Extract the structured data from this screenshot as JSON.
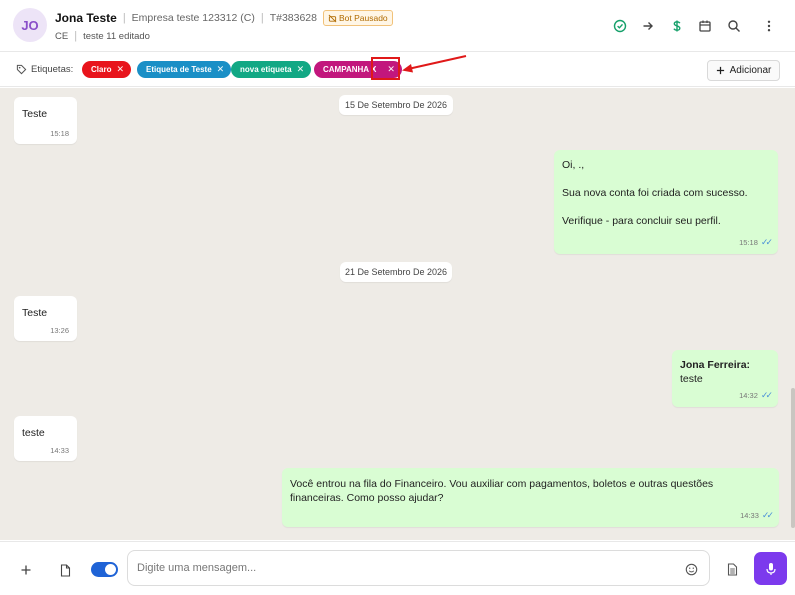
{
  "header": {
    "avatar_initials": "JO",
    "contact_name": "Jona Teste",
    "company": "Empresa teste 123312 (C)",
    "ticket": "T#383628",
    "bot_badge": "Bot Pausado",
    "state": "CE",
    "status_text": "teste 11 editado",
    "icons": [
      "check-circle-icon",
      "arrow-right-icon",
      "dollar-icon",
      "calendar-icon",
      "search-icon",
      "more-vertical-icon"
    ]
  },
  "tags_bar": {
    "label": "Etiquetas:",
    "tags": [
      {
        "label": "Claro",
        "color": "#e8141c"
      },
      {
        "label": "Etiqueta de Teste",
        "color": "#1a8fc6"
      },
      {
        "label": "nova etiqueta",
        "color": "#12a884"
      },
      {
        "label": "CAMPANHA X",
        "color": "#c2177d"
      }
    ],
    "add_label": "Adicionar",
    "highlight_color": "#e01919"
  },
  "chat": {
    "dates": [
      "15 De Setembro De 2026",
      "21 De Setembro De 2026"
    ],
    "messages": [
      {
        "direction": "in",
        "text": "Teste",
        "time": "15:18"
      },
      {
        "direction": "out",
        "lines": [
          "Oi, .,",
          "",
          "Sua nova conta foi criada com sucesso.",
          "",
          "Verifique - para concluir seu perfil."
        ],
        "time": "15:18",
        "read": true
      },
      {
        "direction": "in",
        "text": "Teste",
        "time": "13:26"
      },
      {
        "direction": "out",
        "author": "Jona Ferreira:",
        "text": "teste",
        "time": "14:32",
        "read": true
      },
      {
        "direction": "in",
        "text": "teste",
        "time": "14:33"
      },
      {
        "direction": "out",
        "lines": [
          "Você entrou na fila do Financeiro. Vou auxiliar com pagamentos, boletos e outras questões",
          "financeiras. Como posso ajudar?"
        ],
        "time": "14:33",
        "read": true
      }
    ]
  },
  "composer": {
    "placeholder": "Digite uma mensagem...",
    "value": "",
    "toggle_on": true
  },
  "colors": {
    "accent": "#7c3aed",
    "toggle": "#1f63d6",
    "chat_bg": "#eeebe6",
    "outgoing_bubble": "#d9fdd3",
    "read_check": "#4a90d9"
  }
}
